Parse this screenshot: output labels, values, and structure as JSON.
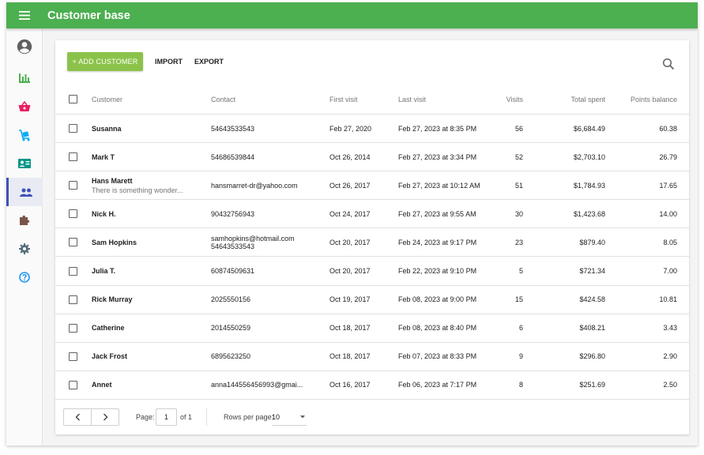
{
  "app": {
    "title": "Customer base"
  },
  "colors": {
    "appbar": "#4caf50",
    "add_button": "#8bc34a",
    "active_nav": "#3f51b5"
  },
  "sidebar": {
    "items": [
      {
        "icon": "account-circle-icon",
        "color": "#616161"
      },
      {
        "icon": "bar-chart-icon",
        "color": "#4caf50"
      },
      {
        "icon": "shopping-basket-icon",
        "color": "#e91e63"
      },
      {
        "icon": "delivery-cart-icon",
        "color": "#03a9f4"
      },
      {
        "icon": "contact-card-icon",
        "color": "#009688"
      },
      {
        "icon": "people-icon",
        "color": "#3f51b5",
        "active": true
      },
      {
        "icon": "puzzle-icon",
        "color": "#795548"
      },
      {
        "icon": "gear-icon",
        "color": "#546e7a"
      },
      {
        "icon": "help-circle-icon",
        "color": "#2196f3"
      }
    ]
  },
  "toolbar": {
    "add_label": "+ ADD CUSTOMER",
    "import_label": "IMPORT",
    "export_label": "EXPORT",
    "search_icon": "search-icon"
  },
  "table": {
    "columns": [
      "Customer",
      "Contact",
      "First visit",
      "Last visit",
      "Visits",
      "Total spent",
      "Points balance"
    ],
    "rows": [
      {
        "name": "Susanna",
        "note": "",
        "contact": "54643533543",
        "contact2": "",
        "first_visit": "Feb 27, 2020",
        "last_visit": "Feb 27, 2023 at 8:35 PM",
        "visits": "56",
        "total_spent": "$6,684.49",
        "points": "60.38"
      },
      {
        "name": "Mark T",
        "note": "",
        "contact": "54686539844",
        "contact2": "",
        "first_visit": "Oct 26, 2014",
        "last_visit": "Feb 27, 2023 at 3:34 PM",
        "visits": "52",
        "total_spent": "$2,703.10",
        "points": "26.79"
      },
      {
        "name": "Hans Marett",
        "note": "There is something wonder...",
        "contact": "hansmarret-dr@yahoo.com",
        "contact2": "",
        "first_visit": "Oct 26, 2017",
        "last_visit": "Feb 27, 2023 at 10:12 AM",
        "visits": "51",
        "total_spent": "$1,784.93",
        "points": "17.65"
      },
      {
        "name": "Nick H.",
        "note": "",
        "contact": "90432756943",
        "contact2": "",
        "first_visit": "Oct 24, 2017",
        "last_visit": "Feb 27, 2023 at 9:55 AM",
        "visits": "30",
        "total_spent": "$1,423.68",
        "points": "14.00"
      },
      {
        "name": "Sam Hopkins",
        "note": "",
        "contact": "samhopkins@hotmail.com",
        "contact2": "54643533543",
        "first_visit": "Oct 20, 2017",
        "last_visit": "Feb 24, 2023 at 9:17 PM",
        "visits": "23",
        "total_spent": "$879.40",
        "points": "8.05"
      },
      {
        "name": "Julia T.",
        "note": "",
        "contact": "60874509631",
        "contact2": "",
        "first_visit": "Oct 20, 2017",
        "last_visit": "Feb 22, 2023 at 9:10 PM",
        "visits": "5",
        "total_spent": "$721.34",
        "points": "7.00"
      },
      {
        "name": "Rick Murray",
        "note": "",
        "contact": "2025550156",
        "contact2": "",
        "first_visit": "Oct 19, 2017",
        "last_visit": "Feb 08, 2023 at 9:00 PM",
        "visits": "15",
        "total_spent": "$424.58",
        "points": "10.81"
      },
      {
        "name": "Catherine",
        "note": "",
        "contact": "2014550259",
        "contact2": "",
        "first_visit": "Oct 18, 2017",
        "last_visit": "Feb 08, 2023 at 8:40 PM",
        "visits": "6",
        "total_spent": "$408.21",
        "points": "3.43"
      },
      {
        "name": "Jack Frost",
        "note": "",
        "contact": "6895623250",
        "contact2": "",
        "first_visit": "Oct 18, 2017",
        "last_visit": "Feb 07, 2023 at 8:33 PM",
        "visits": "9",
        "total_spent": "$296.80",
        "points": "2.90"
      },
      {
        "name": "Annet",
        "note": "",
        "contact": "anna144556456993@gmai...",
        "contact2": "",
        "first_visit": "Oct 16, 2017",
        "last_visit": "Feb 06, 2023 at 7:17 PM",
        "visits": "8",
        "total_spent": "$251.69",
        "points": "2.50"
      }
    ]
  },
  "pagination": {
    "page_label": "Page:",
    "page_value": "1",
    "of_label": "of 1",
    "rows_per_page_label": "Rows per page:",
    "rows_per_page_value": "10"
  }
}
